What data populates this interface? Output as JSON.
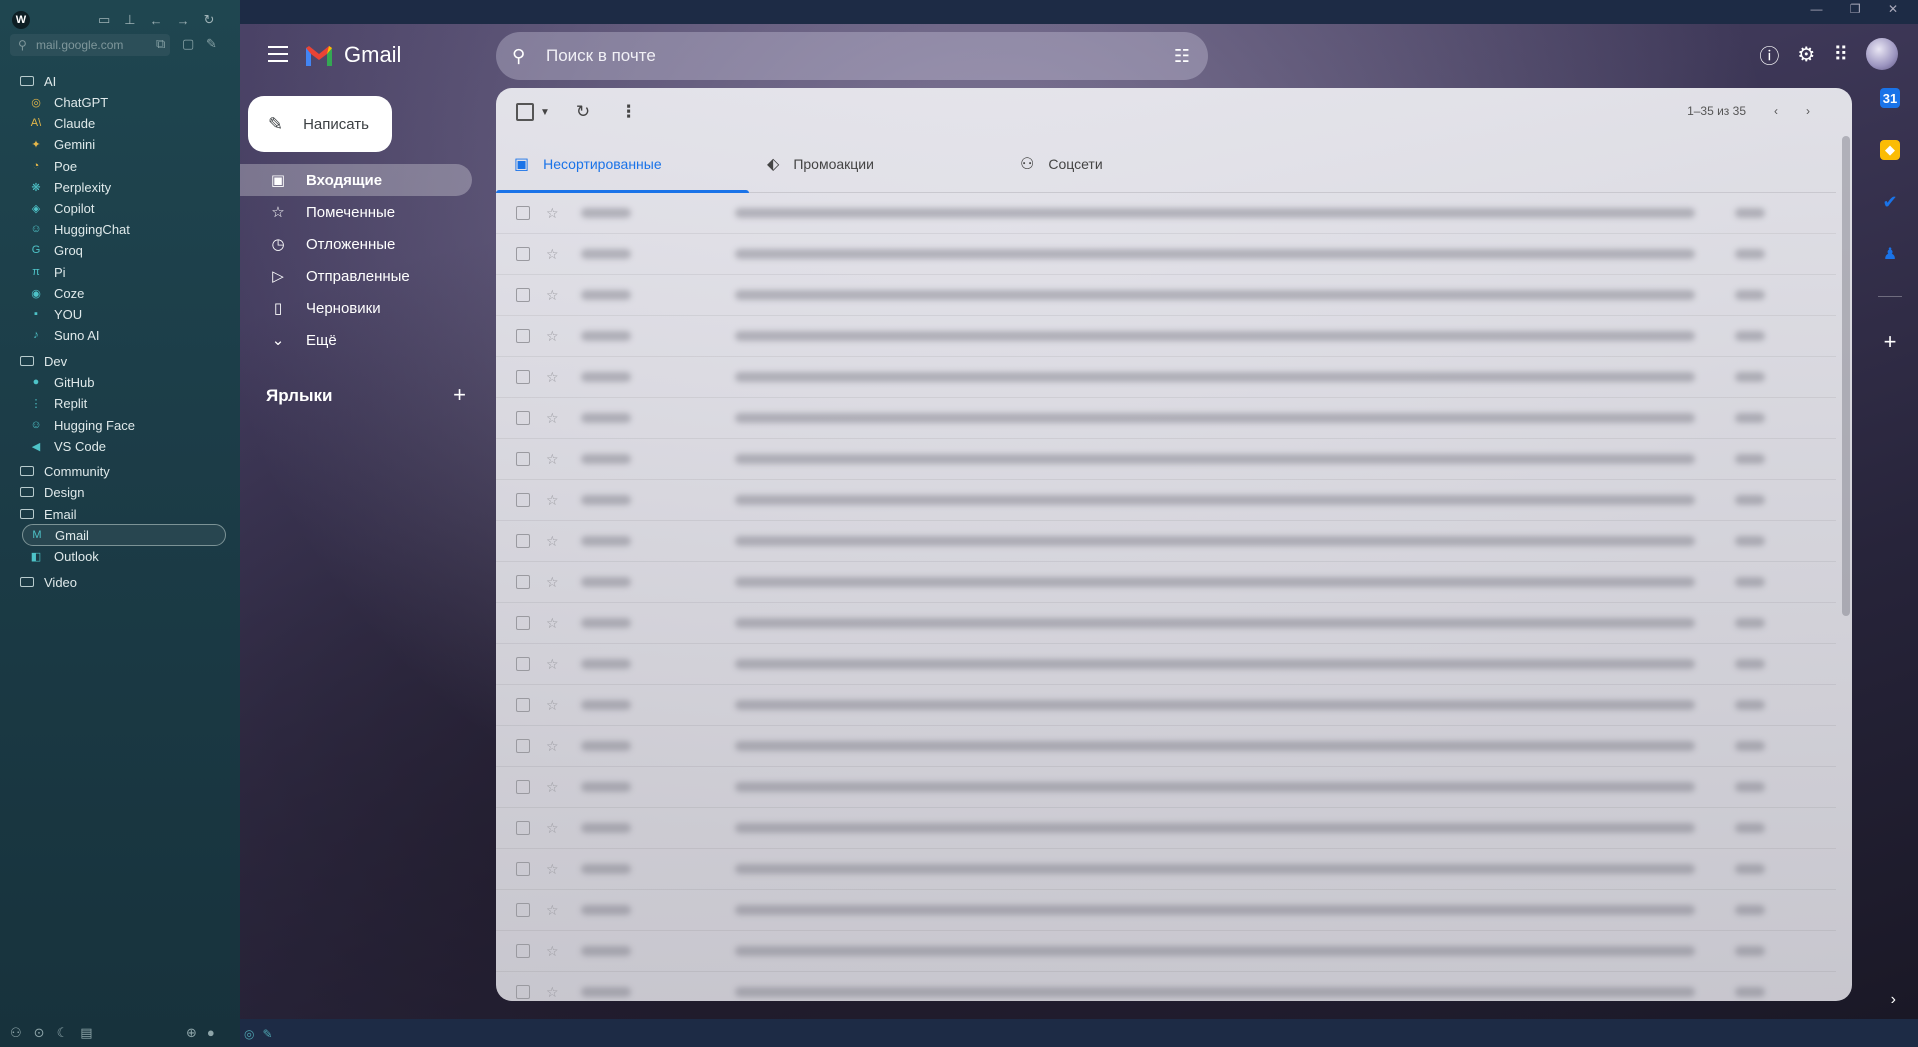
{
  "browser": {
    "url": "mail.google.com",
    "window_controls": "— ❐ ✕",
    "logo": "W",
    "tree": [
      {
        "kind": "folder",
        "label": "AI"
      },
      {
        "kind": "site",
        "label": "ChatGPT",
        "icon": "chatgpt-icon",
        "glyph": "◎",
        "color": "#e6b84a"
      },
      {
        "kind": "site",
        "label": "Claude",
        "icon": "claude-icon",
        "glyph": "A\\",
        "color": "#e6b84a"
      },
      {
        "kind": "site",
        "label": "Gemini",
        "icon": "gemini-icon",
        "glyph": "✦",
        "color": "#e6b84a"
      },
      {
        "kind": "site",
        "label": "Poe",
        "icon": "poe-icon",
        "glyph": "◔",
        "color": "#e6b84a"
      },
      {
        "kind": "site",
        "label": "Perplexity",
        "icon": "perplexity-icon",
        "glyph": "❋",
        "color": "#4ec3c8"
      },
      {
        "kind": "site",
        "label": "Copilot",
        "icon": "copilot-icon",
        "glyph": "◈",
        "color": "#4ec3c8"
      },
      {
        "kind": "site",
        "label": "HuggingChat",
        "icon": "huggingchat-icon",
        "glyph": "☺",
        "color": "#4ec3c8"
      },
      {
        "kind": "site",
        "label": "Groq",
        "icon": "groq-icon",
        "glyph": "G",
        "color": "#4ec3c8"
      },
      {
        "kind": "site",
        "label": "Pi",
        "icon": "pi-icon",
        "glyph": "π",
        "color": "#4ec3c8"
      },
      {
        "kind": "site",
        "label": "Coze",
        "icon": "coze-icon",
        "glyph": "◉",
        "color": "#4ec3c8"
      },
      {
        "kind": "site",
        "label": "YOU",
        "icon": "you-icon",
        "glyph": "▪",
        "color": "#4ec3c8"
      },
      {
        "kind": "site",
        "label": "Suno AI",
        "icon": "suno-icon",
        "glyph": "♪",
        "color": "#4ec3c8"
      },
      {
        "kind": "folder",
        "label": "Dev"
      },
      {
        "kind": "site",
        "label": "GitHub",
        "icon": "github-icon",
        "glyph": "●",
        "color": "#4ec3c8"
      },
      {
        "kind": "site",
        "label": "Replit",
        "icon": "replit-icon",
        "glyph": "⋮",
        "color": "#4ec3c8"
      },
      {
        "kind": "site",
        "label": "Hugging Face",
        "icon": "huggingface-icon",
        "glyph": "☺",
        "color": "#4ec3c8"
      },
      {
        "kind": "site",
        "label": "VS Code",
        "icon": "vscode-icon",
        "glyph": "◀",
        "color": "#4ec3c8"
      },
      {
        "kind": "folder",
        "label": "Community"
      },
      {
        "kind": "folder",
        "label": "Design"
      },
      {
        "kind": "folder",
        "label": "Email"
      },
      {
        "kind": "site",
        "label": "Gmail",
        "icon": "gmail-icon",
        "glyph": "M",
        "color": "#4ec3c8",
        "active": true
      },
      {
        "kind": "site",
        "label": "Outlook",
        "icon": "outlook-icon",
        "glyph": "◧",
        "color": "#4ec3c8"
      },
      {
        "kind": "folder",
        "label": "Video"
      }
    ]
  },
  "gmail": {
    "brand": "Gmail",
    "search_placeholder": "Поиск в почте",
    "compose": "Написать",
    "nav": [
      {
        "label": "Входящие",
        "icon": "inbox-icon",
        "glyph": "▣",
        "active": true
      },
      {
        "label": "Помеченные",
        "icon": "star-icon",
        "glyph": "☆"
      },
      {
        "label": "Отложенные",
        "icon": "clock-icon",
        "glyph": "◷"
      },
      {
        "label": "Отправленные",
        "icon": "send-icon",
        "glyph": "▷"
      },
      {
        "label": "Черновики",
        "icon": "draft-icon",
        "glyph": "▯"
      },
      {
        "label": "Ещё",
        "icon": "chevron-down-icon",
        "glyph": "⌄"
      }
    ],
    "labels_heading": "Ярлыки",
    "pager": "1–35 из 35",
    "tabs": [
      {
        "label": "Несортированные",
        "icon": "inbox-tab-icon",
        "glyph": "▣",
        "active": true
      },
      {
        "label": "Промоакции",
        "icon": "tag-icon",
        "glyph": "⬖"
      },
      {
        "label": "Соцсети",
        "icon": "people-icon",
        "glyph": "⚇"
      }
    ],
    "rows_count": 20
  }
}
